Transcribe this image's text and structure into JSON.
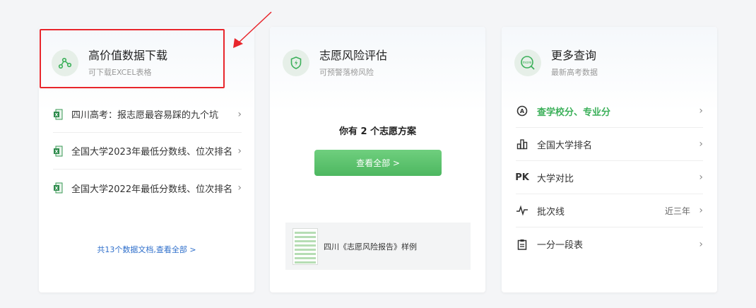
{
  "card1": {
    "title": "高价值数据下载",
    "subtitle": "可下载EXCEL表格",
    "items": [
      {
        "label": "四川高考：报志愿最容易踩的九个坑"
      },
      {
        "label": "全国大学2023年最低分数线、位次排名"
      },
      {
        "label": "全国大学2022年最低分数线、位次排名"
      }
    ],
    "more_link": "共13个数据文档,查看全部 >"
  },
  "card2": {
    "title": "志愿风险评估",
    "subtitle": "可预警落榜风险",
    "plan_text": "你有 2 个志愿方案",
    "view_all": "查看全部 >",
    "report_label": "四川《志愿风险报告》样例"
  },
  "card3": {
    "title": "更多查询",
    "subtitle": "最新高考数据",
    "icon_text": "more",
    "items": [
      {
        "label": "查学校分、专业分",
        "icon": "school-score-icon"
      },
      {
        "label": "全国大学排名",
        "icon": "ranking-icon"
      },
      {
        "label": "大学对比",
        "icon": "pk-icon",
        "icon_text": "PK"
      },
      {
        "label": "批次线",
        "icon": "pulse-icon",
        "note": "近三年"
      },
      {
        "label": "一分一段表",
        "icon": "clipboard-icon"
      }
    ]
  },
  "colors": {
    "accent_green": "#3cb05a",
    "highlight_red": "#e8262c",
    "link_blue": "#2f6fcb"
  }
}
